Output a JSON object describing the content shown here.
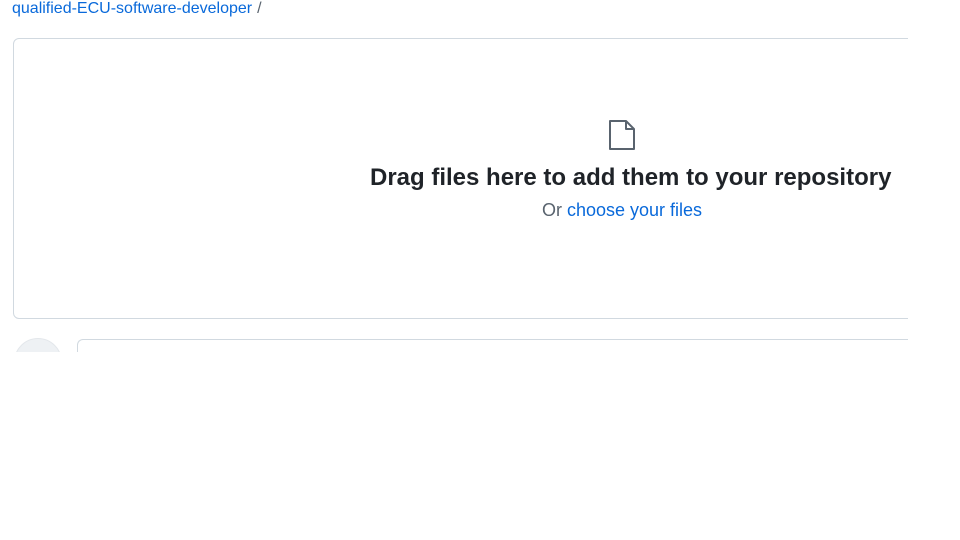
{
  "breadcrumb": {
    "repo": "qualified-ECU-software-developer",
    "separator": "/"
  },
  "dropzone": {
    "icon": "file-icon",
    "title": "Drag files here to add them to your repository",
    "prefix": "Or",
    "link": "choose your files"
  },
  "commit": {
    "avatar_icon": "avatar"
  },
  "colors": {
    "link": "#0969da",
    "border": "#d1d9e0",
    "text": "#1f2328",
    "muted": "#59636e"
  }
}
